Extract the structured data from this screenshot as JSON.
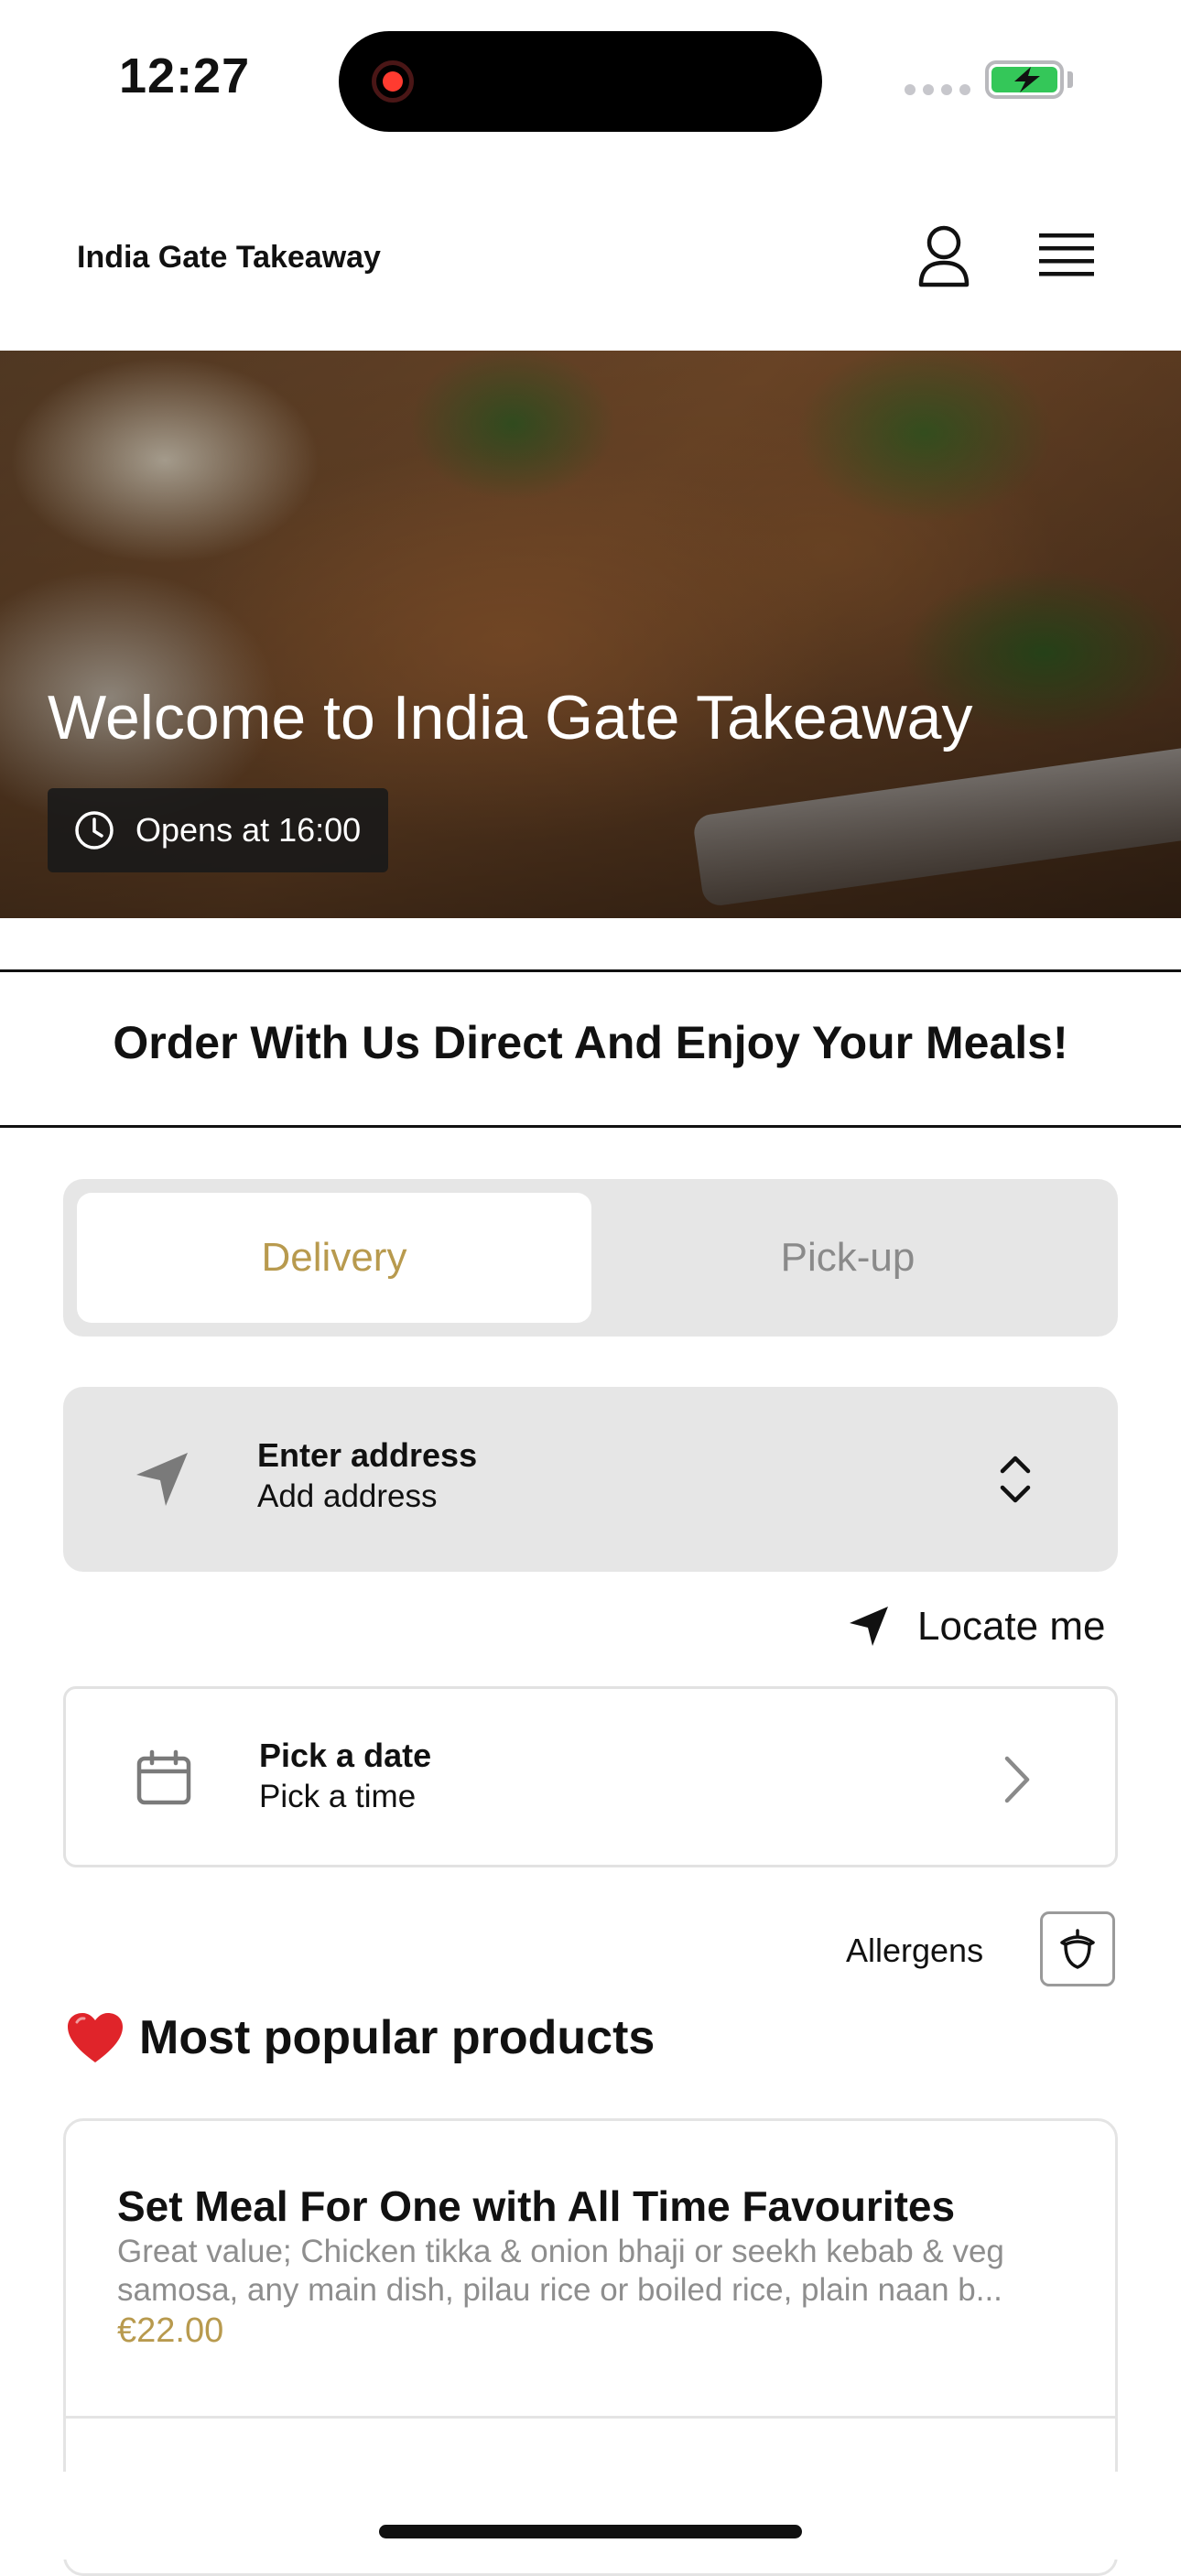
{
  "status_bar": {
    "time": "12:27"
  },
  "header": {
    "brand": "India Gate Takeaway"
  },
  "hero": {
    "title": "Welcome to India Gate Takeaway",
    "hours_badge": "Opens at 16:00"
  },
  "tagline": "Order With Us Direct And Enjoy Your Meals!",
  "order_mode": {
    "tabs": [
      {
        "label": "Delivery",
        "active": true
      },
      {
        "label": "Pick-up",
        "active": false
      }
    ]
  },
  "address": {
    "title": "Enter address",
    "subtitle": "Add address"
  },
  "locate": {
    "label": "Locate me"
  },
  "schedule": {
    "date_label": "Pick a date",
    "time_label": "Pick a time"
  },
  "allergens": {
    "label": "Allergens"
  },
  "popular": {
    "heading": "Most popular products",
    "products": [
      {
        "name": "Set Meal For One with All Time Favourites",
        "description": "Great value; Chicken tikka & onion bhaji or seekh kebab & veg samosa, any main dish, pilau rice or boiled rice, plain naan b...",
        "price": "€22.00"
      }
    ]
  },
  "colors": {
    "accent": "#b89a4e",
    "muted": "#8e8e8e",
    "panel": "#e6e6e6"
  }
}
